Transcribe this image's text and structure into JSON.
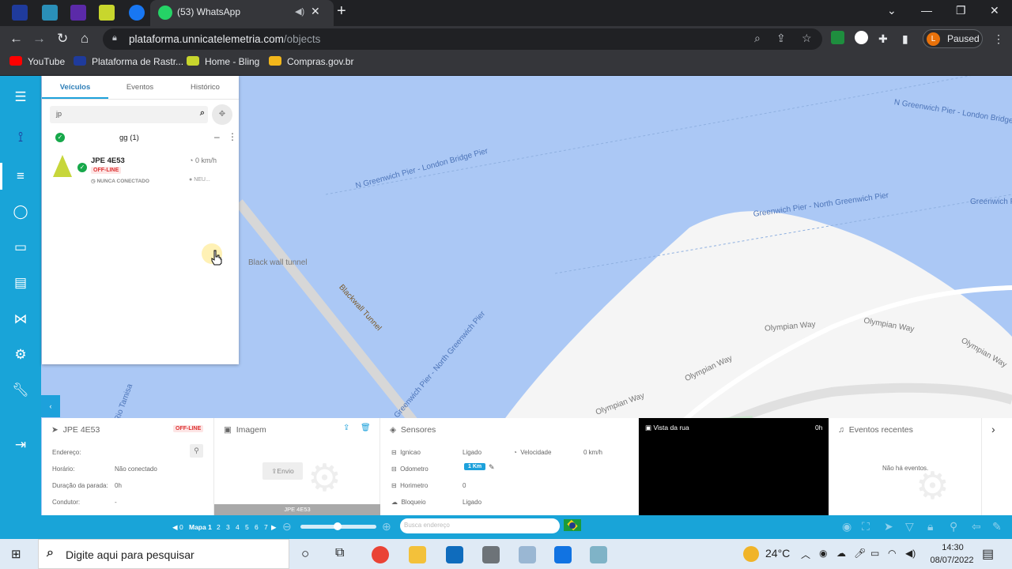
{
  "browser": {
    "active_tab_title": "(53) WhatsApp",
    "url_host": "plataforma.unnicatelemetria.com",
    "url_path": "/objects",
    "profile_initial": "L",
    "profile_status": "Paused",
    "bookmarks": [
      "YouTube",
      "Plataforma de Rastr...",
      "Home - Bling",
      "Compras.gov.br"
    ]
  },
  "panel": {
    "tabs": [
      "Veículos",
      "Eventos",
      "Histórico"
    ],
    "search_value": "jp",
    "group_label": "gg (1)",
    "vehicle": {
      "name": "JPE 4E53",
      "status": "OFF-LINE",
      "speed": "0 km/h",
      "connection": "NUNCA CONECTADO",
      "ignition_short": "NEU..."
    }
  },
  "map": {
    "labels": [
      "N Greenwich Pier - London Bridge",
      "N Greenwich Pier - London Bridge Pier",
      "Greenwich Pier - North Greenwich Pier",
      "Greenwich Pier",
      "Black wall tunnel",
      "Blackwall Tunnel",
      "Greenwich Pier - North Greenwich Pier",
      "Olympian Way",
      "Olympian Way",
      "Olympian Way",
      "Olympian Way",
      "Olympian Way",
      "Rio Tamisa"
    ]
  },
  "info_vehicle": {
    "title": "JPE 4E53",
    "status": "OFF-LINE",
    "rows": [
      {
        "k": "Endereço:",
        "v": ""
      },
      {
        "k": "Horário:",
        "v": "Não conectado"
      },
      {
        "k": "Duração da parada:",
        "v": "0h"
      },
      {
        "k": "Condutor:",
        "v": "-"
      }
    ]
  },
  "info_image": {
    "title": "Imagem",
    "send_label": "Envio",
    "plate": "JPE 4E53"
  },
  "info_sensors": {
    "title": "Sensores",
    "rows": [
      {
        "k": "Ignicao",
        "v": "Ligado"
      },
      {
        "k": "Odometro",
        "v": "1 Km"
      },
      {
        "k": "Horimetro",
        "v": "0"
      },
      {
        "k": "Bloqueio",
        "v": "Ligado"
      }
    ],
    "speed_label": "Velocidade",
    "speed_value": "0 km/h"
  },
  "info_street": {
    "title": "Vista da rua",
    "value": "0h"
  },
  "info_events": {
    "title": "Eventos recentes",
    "empty": "Não há eventos."
  },
  "bottom": {
    "pages": [
      "0",
      "Mapa 1",
      "2",
      "3",
      "4",
      "5",
      "6",
      "7"
    ],
    "address_placeholder": "Busca endereço"
  },
  "taskbar": {
    "search_placeholder": "Digite aqui para pesquisar",
    "weather": "24°C",
    "time": "14:30",
    "date": "08/07/2022"
  },
  "colors": {
    "sidebar": "#19a4d8",
    "water": "#abc8f5",
    "offline": "#d33333",
    "accent": "#1da1db"
  }
}
